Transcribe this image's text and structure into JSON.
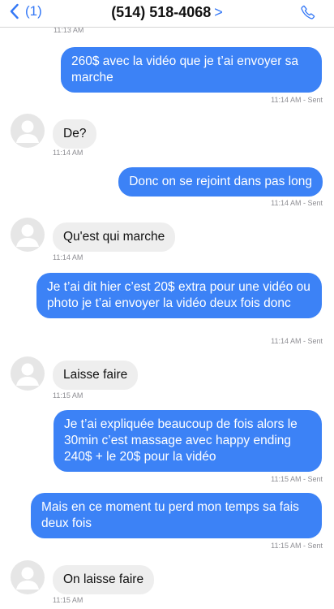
{
  "header": {
    "back_label": "(1)",
    "contact": "(514) 518-4068",
    "contact_chevron": ">"
  },
  "thread": {
    "top_partial_time": "11:13 AM",
    "messages": [
      {
        "dir": "sent",
        "text": "260$ avec la vidéo que je t’ai envoyer sa marche",
        "time": "11:14 AM - Sent"
      },
      {
        "dir": "received",
        "text": "De?",
        "time": "11:14 AM"
      },
      {
        "dir": "sent",
        "text": "Donc on se rejoint dans pas long",
        "time": "11:14 AM - Sent"
      },
      {
        "dir": "received",
        "text": "Qu'est qui marche",
        "time": "11:14 AM"
      },
      {
        "dir": "sent",
        "text": "Je t’ai dit hier c’est 20$ extra pour une vidéo ou photo je t’ai envoyer la vidéo deux fois donc",
        "time": "11:14 AM - Sent"
      },
      {
        "dir": "received",
        "text": "Laisse faire",
        "time": "11:15 AM"
      },
      {
        "dir": "sent",
        "text": "Je t’ai expliquée beaucoup de fois alors le 30min c’est massage avec happy ending 240$ + le 20$ pour la vidéo",
        "time": "11:15 AM - Sent"
      },
      {
        "dir": "sent",
        "text": "Mais en ce moment tu perd mon temps sa fais deux fois",
        "time": "11:15 AM - Sent"
      },
      {
        "dir": "received",
        "text": "On laisse faire",
        "time": "11:15 AM"
      }
    ]
  },
  "colors": {
    "sent_bubble": "#3c82f6",
    "received_bubble": "#eeeeee",
    "accent": "#3478f6",
    "timestamp": "#8e8e93"
  },
  "icons": {
    "back": "chevron-left-icon",
    "call": "phone-icon",
    "avatar": "person-silhouette-icon"
  }
}
